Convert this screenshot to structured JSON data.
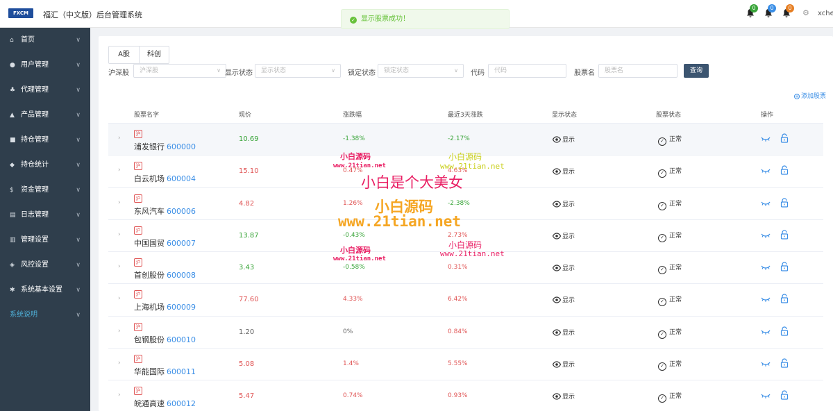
{
  "header": {
    "logo_text": "FXCM",
    "title": "福汇（中文版）后台管理系统",
    "toast": "显示股票成功！",
    "notifications": [
      {
        "count": "0",
        "color": "#3aa53a"
      },
      {
        "count": "0",
        "color": "#3a8ee6"
      },
      {
        "count": "0",
        "color": "#e67e22"
      }
    ],
    "username": "xcher"
  },
  "sidebar": {
    "items": [
      {
        "label": "首页",
        "icon": "home-icon"
      },
      {
        "label": "用户管理",
        "icon": "user-icon"
      },
      {
        "label": "代理管理",
        "icon": "org-icon"
      },
      {
        "label": "产品管理",
        "icon": "product-icon"
      },
      {
        "label": "持仓管理",
        "icon": "holding-icon"
      },
      {
        "label": "持仓统计",
        "icon": "stats-icon"
      },
      {
        "label": "资金管理",
        "icon": "money-icon"
      },
      {
        "label": "日志管理",
        "icon": "log-icon"
      },
      {
        "label": "管理设置",
        "icon": "admin-icon"
      },
      {
        "label": "风控设置",
        "icon": "shield-icon"
      },
      {
        "label": "系统基本设置",
        "icon": "gear-icon"
      },
      {
        "label": "系统说明",
        "icon": ""
      }
    ]
  },
  "tabs": [
    "A股",
    "科创"
  ],
  "filters": {
    "market_label": "沪深股",
    "market_placeholder": "沪深股",
    "display_label": "显示状态",
    "display_placeholder": "显示状态",
    "lock_label": "锁定状态",
    "lock_placeholder": "锁定状态",
    "code_label": "代码",
    "code_placeholder": "代码",
    "name_label": "股票名",
    "name_placeholder": "股票名",
    "query_button": "查询"
  },
  "add_stock": "添加股票",
  "table": {
    "headers": [
      "股票名字",
      "现价",
      "涨跌幅",
      "最近3天涨跌",
      "显示状态",
      "股票状态",
      "操作"
    ],
    "rows": [
      {
        "tag": "沪",
        "name": "浦发银行",
        "code": "600000",
        "price": "10.69",
        "change": "-1.38%",
        "change3": "-2.17%",
        "display": "显示",
        "status": "正常"
      },
      {
        "tag": "沪",
        "name": "白云机场",
        "code": "600004",
        "price": "15.10",
        "change": "0.47%",
        "change3": "4.63%",
        "display": "显示",
        "status": "正常"
      },
      {
        "tag": "沪",
        "name": "东风汽车",
        "code": "600006",
        "price": "4.82",
        "change": "1.26%",
        "change3": "-2.38%",
        "display": "显示",
        "status": "正常"
      },
      {
        "tag": "沪",
        "name": "中国国贸",
        "code": "600007",
        "price": "13.87",
        "change": "-0.43%",
        "change3": "2.73%",
        "display": "显示",
        "status": "正常"
      },
      {
        "tag": "沪",
        "name": "首创股份",
        "code": "600008",
        "price": "3.43",
        "change": "-0.58%",
        "change3": "0.31%",
        "display": "显示",
        "status": "正常"
      },
      {
        "tag": "沪",
        "name": "上海机场",
        "code": "600009",
        "price": "77.60",
        "change": "4.33%",
        "change3": "6.42%",
        "display": "显示",
        "status": "正常"
      },
      {
        "tag": "沪",
        "name": "包钢股份",
        "code": "600010",
        "price": "1.20",
        "change": "0%",
        "change3": "0.84%",
        "display": "显示",
        "status": "正常"
      },
      {
        "tag": "沪",
        "name": "华能国际",
        "code": "600011",
        "price": "5.08",
        "change": "1.4%",
        "change3": "5.55%",
        "display": "显示",
        "status": "正常"
      },
      {
        "tag": "沪",
        "name": "皖通高速",
        "code": "600012",
        "price": "5.47",
        "change": "0.74%",
        "change3": "0.93%",
        "display": "显示",
        "status": "正常"
      }
    ]
  },
  "watermark": {
    "line1": "小白源码",
    "line2": "www.21tian.net",
    "line3": "小白是个大美女"
  }
}
